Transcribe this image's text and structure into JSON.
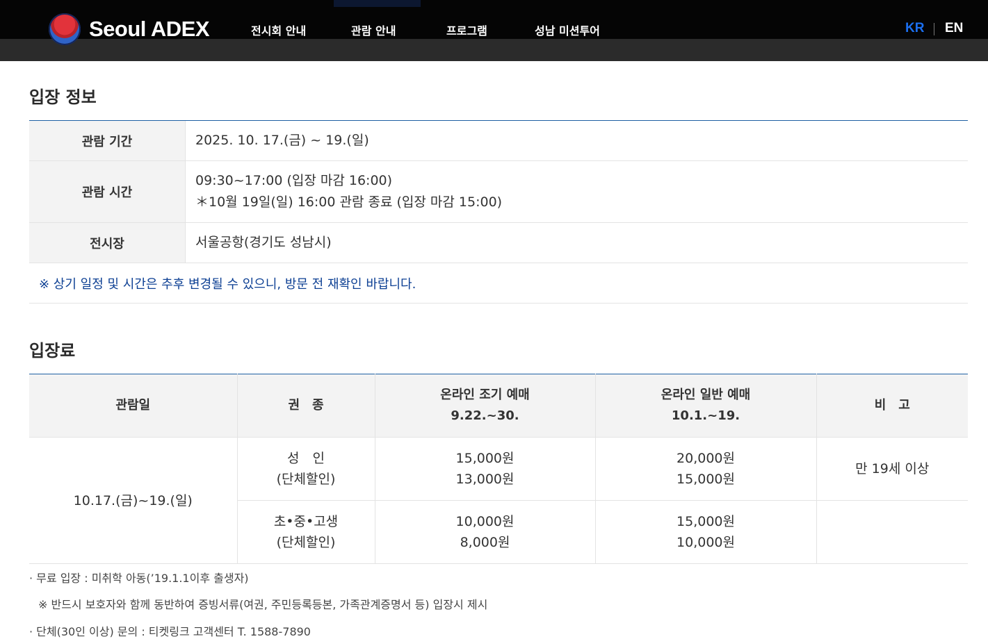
{
  "header": {
    "logo_text": "Seoul ADEX",
    "logo_icon": "globe-emblem-icon",
    "nav": [
      "전시회 안내",
      "관람 안내",
      "프로그램",
      "성남 미션투어"
    ],
    "lang_kr": "KR",
    "lang_en": "EN",
    "colors": {
      "active_lang": "#1b6ff0",
      "bar": "#050505"
    }
  },
  "admission_info": {
    "title": "입장 정보",
    "rows": [
      {
        "label": "관람 기간",
        "lines": [
          "2025. 10. 17.(금) ~ 19.(일)"
        ]
      },
      {
        "label": "관람 시간",
        "lines": [
          "09:30~17:00 (입장 마감 16:00)",
          "＊10월 19일(일) 16:00 관람 종료 (입장 마감 15:00)"
        ]
      },
      {
        "label": "전시장",
        "lines": [
          "서울공항(경기도 성남시)"
        ]
      }
    ],
    "notice": "※ 상기 일정 및 시간은 추후 변경될 수 있으니, 방문 전 재확인 바랍니다.",
    "notice_color": "#0c3f93"
  },
  "fees": {
    "title": "입장료",
    "headers": {
      "date": "관람일",
      "type": "권　종",
      "early": [
        "온라인 조기 예매",
        "9.22.~30."
      ],
      "general": [
        "온라인 일반 예매",
        "10.1.~19."
      ],
      "note": "비　고"
    },
    "date": "10.17.(금)~19.(일)",
    "rows": [
      {
        "type": [
          "성　인",
          "(단체할인)"
        ],
        "early": [
          "15,000원",
          "13,000원"
        ],
        "general": [
          "20,000원",
          "15,000원"
        ],
        "note": "만 19세 이상"
      },
      {
        "type": [
          "초•중•고생",
          "(단체할인)"
        ],
        "early": [
          "10,000원",
          "8,000원"
        ],
        "general": [
          "15,000원",
          "10,000원"
        ],
        "note": ""
      }
    ],
    "notes": [
      "· 무료 입장 : 미취학 아동(’19.1.1이후 출생자)",
      "※ 반드시 보호자와 함께 동반하여 증빙서류(여권, 주민등록등본, 가족관계증명서 등) 입장시 제시",
      "· 단체(30인 이상) 문의 : 티켓링크 고객센터 T. 1588-7890"
    ]
  }
}
